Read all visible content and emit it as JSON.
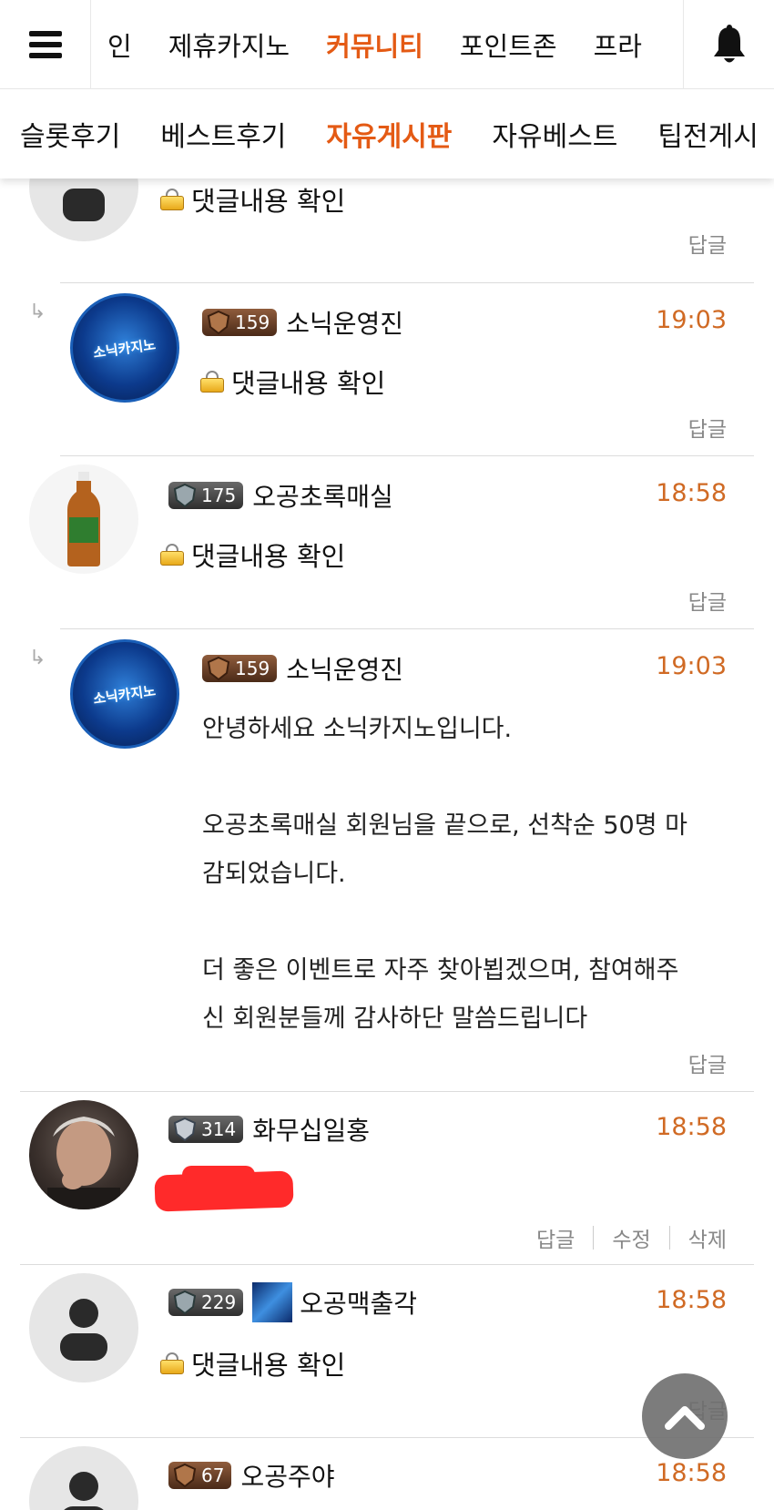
{
  "topnav": {
    "tabs": [
      {
        "label": "인",
        "active": false
      },
      {
        "label": "제휴카지노",
        "active": false
      },
      {
        "label": "커뮤니티",
        "active": true
      },
      {
        "label": "포인트존",
        "active": false
      },
      {
        "label": "프라",
        "active": false
      }
    ],
    "menu_icon": "hamburger-icon",
    "bell_icon": "bell-icon"
  },
  "subnav": {
    "tabs": [
      {
        "label": "슬롯후기",
        "active": false
      },
      {
        "label": "베스트후기",
        "active": false
      },
      {
        "label": "자유게시판",
        "active": true
      },
      {
        "label": "자유베스트",
        "active": false
      },
      {
        "label": "팁전게시",
        "active": false
      }
    ]
  },
  "colors": {
    "accent": "#e45a14",
    "time": "#d06a24",
    "redaction": "#ff2a2a"
  },
  "comments": [
    {
      "user": "",
      "locked_text": "댓글내용 확인",
      "actions": [
        "답글"
      ]
    },
    {
      "is_reply": true,
      "level": "159",
      "user": "소닉운영진",
      "time": "19:03",
      "locked_text": "댓글내용 확인",
      "actions": [
        "답글"
      ],
      "avatar_text": "소닉카지노"
    },
    {
      "level": "175",
      "user": "오공초록매실",
      "time": "18:58",
      "locked_text": "댓글내용 확인",
      "actions": [
        "답글"
      ]
    },
    {
      "is_reply": true,
      "level": "159",
      "user": "소닉운영진",
      "time": "19:03",
      "avatar_text": "소닉카지노",
      "body": [
        "안녕하세요 소닉카지노입니다.",
        "",
        "오공초록매실 회원님을 끝으로, 선착순 50명 마",
        "감되었습니다.",
        "",
        "더 좋은 이벤트로 자주 찾아뵙겠으며, 참여해주",
        "신 회원분들께 감사하단 말씀드립니다"
      ],
      "actions": [
        "답글"
      ]
    },
    {
      "level": "314",
      "user": "화무십일홍",
      "time": "18:58",
      "actions": [
        "답글",
        "수정",
        "삭제"
      ]
    },
    {
      "level": "229",
      "user": "오공맥출각",
      "time": "18:58",
      "locked_text": "댓글내용 확인",
      "actions": [
        "답글"
      ]
    },
    {
      "level": "67",
      "user": "오공주야",
      "time": "18:58"
    }
  ],
  "fab_icon": "chevron-up-icon"
}
